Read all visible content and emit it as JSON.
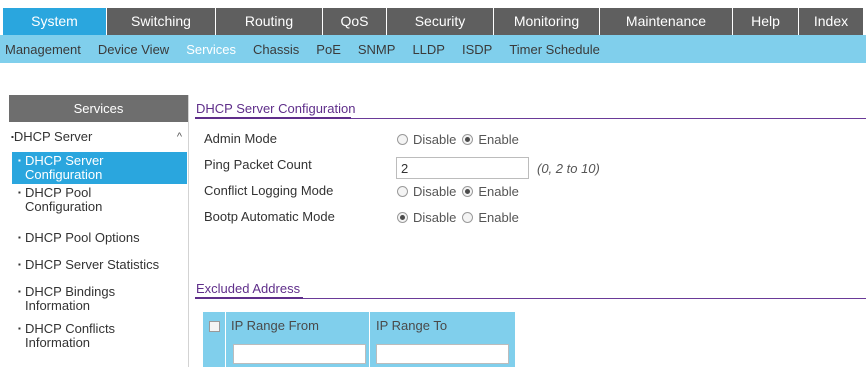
{
  "top_nav": [
    {
      "label": "System",
      "active": true
    },
    {
      "label": "Switching",
      "active": false
    },
    {
      "label": "Routing",
      "active": false
    },
    {
      "label": "QoS",
      "active": false
    },
    {
      "label": "Security",
      "active": false
    },
    {
      "label": "Monitoring",
      "active": false
    },
    {
      "label": "Maintenance",
      "active": false
    },
    {
      "label": "Help",
      "active": false
    },
    {
      "label": "Index",
      "active": false
    }
  ],
  "sub_nav": [
    {
      "label": "Management",
      "active": false
    },
    {
      "label": "Device View",
      "active": false
    },
    {
      "label": "Services",
      "active": true
    },
    {
      "label": "Chassis",
      "active": false
    },
    {
      "label": "PoE",
      "active": false
    },
    {
      "label": "SNMP",
      "active": false
    },
    {
      "label": "LLDP",
      "active": false
    },
    {
      "label": "ISDP",
      "active": false
    },
    {
      "label": "Timer Schedule",
      "active": false
    }
  ],
  "sidebar": {
    "header": "Services",
    "group": "DHCP Server",
    "group_bullet": "▪",
    "group_chevron": "^",
    "items": [
      {
        "lines": [
          "DHCP Server",
          "Configuration"
        ],
        "active": true
      },
      {
        "lines": [
          "DHCP Pool",
          "Configuration"
        ],
        "active": false
      },
      {
        "lines": [
          "DHCP Pool Options"
        ],
        "active": false
      },
      {
        "lines": [
          "DHCP Server Statistics"
        ],
        "active": false
      },
      {
        "lines": [
          "DHCP Bindings",
          "Information"
        ],
        "active": false
      },
      {
        "lines": [
          "DHCP Conflicts",
          "Information"
        ],
        "active": false
      }
    ]
  },
  "config": {
    "title": "DHCP Server Configuration",
    "admin_mode": {
      "label": "Admin Mode",
      "options": [
        "Disable",
        "Enable"
      ],
      "selected": "Enable"
    },
    "ping_packet_count": {
      "label": "Ping Packet Count",
      "value": "2",
      "hint": "(0, 2 to 10)"
    },
    "conflict_logging_mode": {
      "label": "Conflict Logging Mode",
      "options": [
        "Disable",
        "Enable"
      ],
      "selected": "Enable"
    },
    "bootp_automatic_mode": {
      "label": "Bootp Automatic Mode",
      "options": [
        "Disable",
        "Enable"
      ],
      "selected": "Disable"
    }
  },
  "excluded": {
    "title": "Excluded Address",
    "columns": [
      "IP Range From",
      "IP Range To"
    ]
  },
  "colors": {
    "nav_dark": "#5f5f5f",
    "nav_active": "#2aa6de",
    "subnav_bg": "#80cfec",
    "section_title": "#5f2e8a"
  }
}
